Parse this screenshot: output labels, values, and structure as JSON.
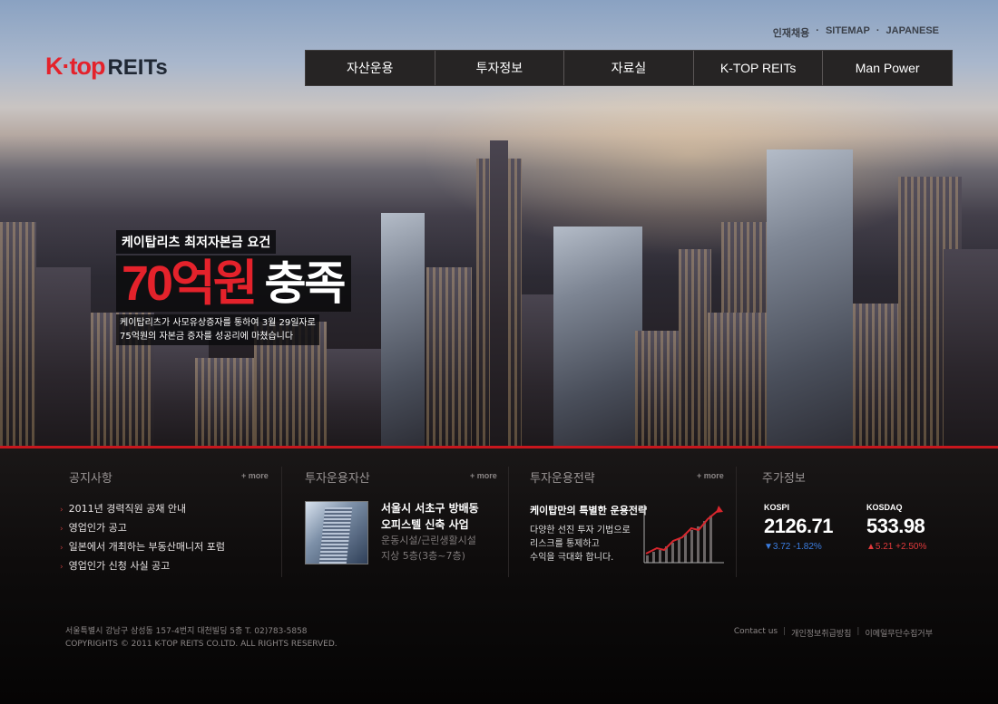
{
  "brand": {
    "logo_k": "K·top",
    "logo_reits": "REITs"
  },
  "util_nav": [
    "인재채용",
    "SITEMAP",
    "JAPANESE"
  ],
  "gnb": [
    "자산운용",
    "투자정보",
    "자료실",
    "K-TOP REITs",
    "Man Power"
  ],
  "hero": {
    "kicker": "케이탑리츠 최저자본금 요건",
    "big_red": "70억원",
    "big_white": "충족",
    "desc_line1": "케이탑리츠가 사모유상증자를 통하여 3월 29일자로",
    "desc_line2": "75억원의 자본금 증자를 성공리에 마쳤습니다"
  },
  "notice": {
    "title": "공지사항",
    "more": "+ more",
    "items": [
      "2011년 경력직원 공채 안내",
      "영업인가 공고",
      "일본에서 개최하는 부동산매니저 포럼",
      "영업인가 신청 사실 공고"
    ]
  },
  "assets": {
    "title": "투자운용자산",
    "more": "+ more",
    "name_line1": "서울시 서초구 방배동",
    "name_line2": "오피스텔 신축 사업",
    "desc_line1": "운동시설/근린생활시설",
    "desc_line2": "지상 5층(3층~7층)"
  },
  "strategy": {
    "title": "투자운용전략",
    "more": "+ more",
    "headline": "케이탑만의 특별한 운용전략",
    "desc_line1": "다양한 선진 투자 기법으로",
    "desc_line2": "리스크를 통제하고",
    "desc_line3": "수익을 극대화 합니다."
  },
  "stocks": {
    "title": "주가정보",
    "kospi": {
      "name": "KOSPI",
      "value": "2126.71",
      "change": "▼3.72  -1.82%"
    },
    "kosdaq": {
      "name": "KOSDAQ",
      "value": "533.98",
      "change": "▲5.21  +2.50%"
    }
  },
  "footer": {
    "address": "서울특별시 강남구 삼성동 157-4번지 대천빌딩 5층    T. 02)783-5858",
    "copyright": "COPYRIGHTS © 2011 K-TOP REITS CO.LTD. ALL RIGHTS RESERVED.",
    "links": [
      "Contact us",
      "개인정보취급방침",
      "이메일무단수집거부"
    ]
  },
  "colors": {
    "accent_red": "#c8161d",
    "down": "#3b7de0",
    "up": "#e0393b"
  }
}
